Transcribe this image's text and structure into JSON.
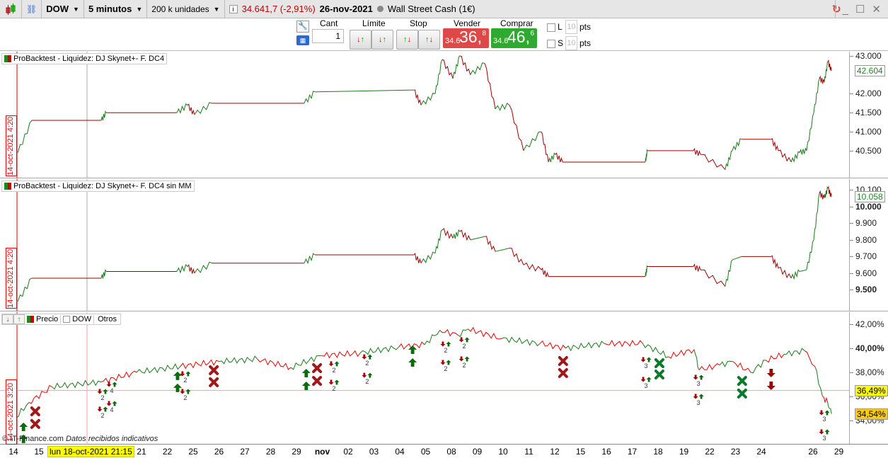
{
  "titlebar": {
    "instrument": "DOW",
    "interval": "5 minutos",
    "units": "200 k unidades",
    "price": "34.641,7 (-2,91%)",
    "date": "26-nov-2021",
    "market": "Wall Street Cash (1€)"
  },
  "toolbar": {
    "cant_label": "Cant",
    "cant_value": "1",
    "limit_label": "Límite",
    "stop_label": "Stop",
    "sell_label": "Vender",
    "sell_prefix": "34.6",
    "sell_big": "36,",
    "sell_sup": "8",
    "buy_label": "Comprar",
    "buy_prefix": "34.6",
    "buy_big": "46,",
    "buy_sup": "6",
    "l_label": "L",
    "s_label": "S",
    "l_pts": "10",
    "s_pts": "10",
    "pts": "pts"
  },
  "colors": {
    "up": "#1a7a1a",
    "down": "#a00000",
    "sell": "#e04848",
    "buy": "#2eaa2e"
  },
  "panels": {
    "p1": {
      "title": "ProBacktest - Liquidez: DJ Skynet+-  F. DC4",
      "date_marker": "14-oct-2021 4:20",
      "current": "42.604"
    },
    "p2": {
      "title": "ProBacktest - Liquidez: DJ Skynet+-  F. DC4 sin MM",
      "date_marker": "14-oct-2021 4:20",
      "current": "10.058"
    },
    "p3": {
      "title": "Precio",
      "dow": "DOW",
      "otros": "Otros",
      "date_marker": "14-oct-2021 3:20",
      "level1": "36,49%",
      "level2": "34,54%",
      "copyright": "© IT-Finance.com",
      "note": "Datos recibidos indicativos"
    }
  },
  "xaxis": {
    "labels": [
      "14",
      "15",
      "21",
      "22",
      "25",
      "26",
      "27",
      "28",
      "29",
      "nov",
      "02",
      "03",
      "04",
      "05",
      "08",
      "09",
      "10",
      "11",
      "12",
      "15",
      "16",
      "17",
      "18",
      "19",
      "22",
      "23",
      "24",
      "26",
      "29"
    ],
    "positions": [
      0,
      1,
      5,
      6,
      7,
      8,
      9,
      10,
      11,
      12,
      13,
      14,
      15,
      16,
      17,
      18,
      19,
      20,
      21,
      22,
      23,
      24,
      25,
      26,
      27,
      28,
      29,
      31,
      32
    ],
    "cursor_label": "lun 18-oct-2021 21:15"
  },
  "chart_data": [
    {
      "type": "line",
      "title": "ProBacktest - Liquidez: DJ Skynet+-  F. DC4",
      "xlim": [
        0,
        32.5
      ],
      "ylim": [
        39.77,
        43.11
      ],
      "yticks": [
        "43.000",
        "42.000",
        "41.500",
        "41.000",
        "40.500"
      ],
      "ytick_values": [
        43.0,
        42.0,
        41.5,
        41.0,
        40.5
      ],
      "x": [
        0.17,
        0.72,
        3.42,
        3.61,
        6.36,
        6.78,
        7.05,
        7.74,
        11.32,
        11.74,
        15.59,
        15.87,
        16.42,
        16.69,
        17.11,
        17.38,
        17.79,
        18.35,
        18.76,
        19.31,
        19.86,
        20.55,
        20.83,
        21.1,
        21.38,
        24.6,
        24.68,
        26.47,
        26.75,
        27.71,
        27.99,
        28.35,
        29.5,
        29.78,
        30.28,
        30.61,
        30.88,
        31.16,
        31.38,
        31.57,
        31.71,
        31.85
      ],
      "y": [
        40.45,
        41.3,
        41.3,
        41.5,
        41.5,
        41.7,
        41.45,
        41.75,
        41.75,
        42.05,
        42.1,
        41.7,
        42.0,
        42.9,
        42.4,
        43.0,
        42.5,
        42.8,
        41.6,
        41.7,
        40.5,
        41.0,
        40.2,
        40.4,
        40.2,
        40.2,
        40.5,
        40.5,
        40.4,
        40.0,
        40.5,
        40.8,
        40.8,
        40.5,
        40.2,
        40.45,
        40.5,
        41.5,
        42.4,
        42.3,
        42.85,
        42.604
      ]
    },
    {
      "type": "line",
      "title": "ProBacktest - Liquidez: DJ Skynet+-  F. DC4 sin MM",
      "xlim": [
        0,
        32.5
      ],
      "ylim": [
        9.37,
        10.165
      ],
      "yticks": [
        "10.100",
        "10.000",
        "9.900",
        "9.800",
        "9.700",
        "9.600",
        "9.500"
      ],
      "ytick_values": [
        10.1,
        10.0,
        9.9,
        9.8,
        9.7,
        9.6,
        9.5
      ],
      "x": [
        0.17,
        0.72,
        3.42,
        3.61,
        6.36,
        6.78,
        7.05,
        7.74,
        11.32,
        11.74,
        15.59,
        15.87,
        16.42,
        16.69,
        17.11,
        17.38,
        17.79,
        18.35,
        18.76,
        19.31,
        19.86,
        20.55,
        20.83,
        21.38,
        24.6,
        24.68,
        26.47,
        26.75,
        27.71,
        27.99,
        28.35,
        29.5,
        29.78,
        30.28,
        30.61,
        30.88,
        31.16,
        31.38,
        31.57,
        31.71,
        31.85
      ],
      "y": [
        9.43,
        9.57,
        9.57,
        9.61,
        9.61,
        9.64,
        9.6,
        9.66,
        9.66,
        9.71,
        9.71,
        9.66,
        9.72,
        9.86,
        9.81,
        9.85,
        9.8,
        9.82,
        9.73,
        9.75,
        9.65,
        9.62,
        9.58,
        9.58,
        9.58,
        9.64,
        9.64,
        9.62,
        9.52,
        9.68,
        9.7,
        9.7,
        9.63,
        9.57,
        9.61,
        9.62,
        9.8,
        10.08,
        10.05,
        10.11,
        10.058
      ]
    },
    {
      "type": "line",
      "title": "Precio",
      "xlim": [
        0,
        32.5
      ],
      "ylim": [
        32.0,
        43.0
      ],
      "yticks": [
        "42,00%",
        "40,00%",
        "38,00%",
        "36,00%",
        "34,00%"
      ],
      "ytick_values": [
        42,
        40,
        38,
        36,
        34
      ],
      "x": [
        0,
        0.6,
        1.5,
        3.4,
        4.8,
        6.5,
        8,
        9.5,
        10.8,
        12,
        13.5,
        15,
        16,
        16.6,
        17.3,
        17.7,
        19,
        20.5,
        21.5,
        23,
        24.5,
        25.5,
        26.5,
        26.7,
        27.5,
        28,
        28.7,
        29.3,
        30,
        30.8,
        31.2,
        31.5,
        31.7,
        31.85
      ],
      "y": [
        34.0,
        35.5,
        36.8,
        37.2,
        38.0,
        38.5,
        38.9,
        39.1,
        38.4,
        39.4,
        39.6,
        40.1,
        40.3,
        41.5,
        41.1,
        41.6,
        40.8,
        40.4,
        40.0,
        40.4,
        40.4,
        39.3,
        39.9,
        38.2,
        38.6,
        38.9,
        38.0,
        39.0,
        39.5,
        39.8,
        38.5,
        36.0,
        35.5,
        34.54
      ],
      "markers": {
        "buy_arrow": [
          [
            0.39,
            33.47
          ],
          [
            0.39,
            32.47
          ],
          [
            6.39,
            37.71
          ],
          [
            6.39,
            36.71
          ],
          [
            11.4,
            37.94
          ],
          [
            11.4,
            36.88
          ],
          [
            15.54,
            38.82
          ],
          [
            15.54,
            39.88
          ]
        ],
        "exit_red_x": [
          [
            0.85,
            34.76
          ],
          [
            0.85,
            33.71
          ],
          [
            7.8,
            38.18
          ],
          [
            7.8,
            37.18
          ],
          [
            11.82,
            38.35
          ],
          [
            11.82,
            37.29
          ],
          [
            21.4,
            38.94
          ],
          [
            21.4,
            37.94
          ]
        ],
        "exit_green_x": [
          [
            25.15,
            38.76
          ],
          [
            25.15,
            37.82
          ],
          [
            28.37,
            37.29
          ],
          [
            28.37,
            36.24
          ]
        ],
        "sell_arrow": [
          [
            29.5,
            37.94
          ],
          [
            29.5,
            36.88
          ]
        ],
        "small_pairs": [
          [
            3.47,
            36.41,
            "2"
          ],
          [
            3.47,
            34.94,
            "2"
          ],
          [
            3.83,
            37.0,
            "4"
          ],
          [
            3.83,
            35.41,
            "4"
          ],
          [
            6.69,
            37.88,
            "2"
          ],
          [
            6.69,
            36.41,
            "2"
          ],
          [
            12.48,
            38.71,
            "2"
          ],
          [
            12.48,
            37.18,
            "2"
          ],
          [
            13.77,
            39.29,
            "2"
          ],
          [
            13.77,
            37.76,
            "2"
          ],
          [
            16.83,
            40.35,
            "2"
          ],
          [
            16.83,
            38.82,
            "2"
          ],
          [
            17.55,
            40.71,
            "2"
          ],
          [
            17.55,
            39.12,
            "2"
          ],
          [
            24.63,
            39.06,
            "3"
          ],
          [
            24.63,
            37.41,
            "3"
          ],
          [
            26.67,
            37.59,
            "3"
          ],
          [
            26.67,
            36.0,
            "3"
          ],
          [
            31.57,
            34.65,
            "3"
          ],
          [
            31.57,
            33.06,
            "3"
          ]
        ]
      },
      "hlines": [
        36.49
      ]
    }
  ]
}
